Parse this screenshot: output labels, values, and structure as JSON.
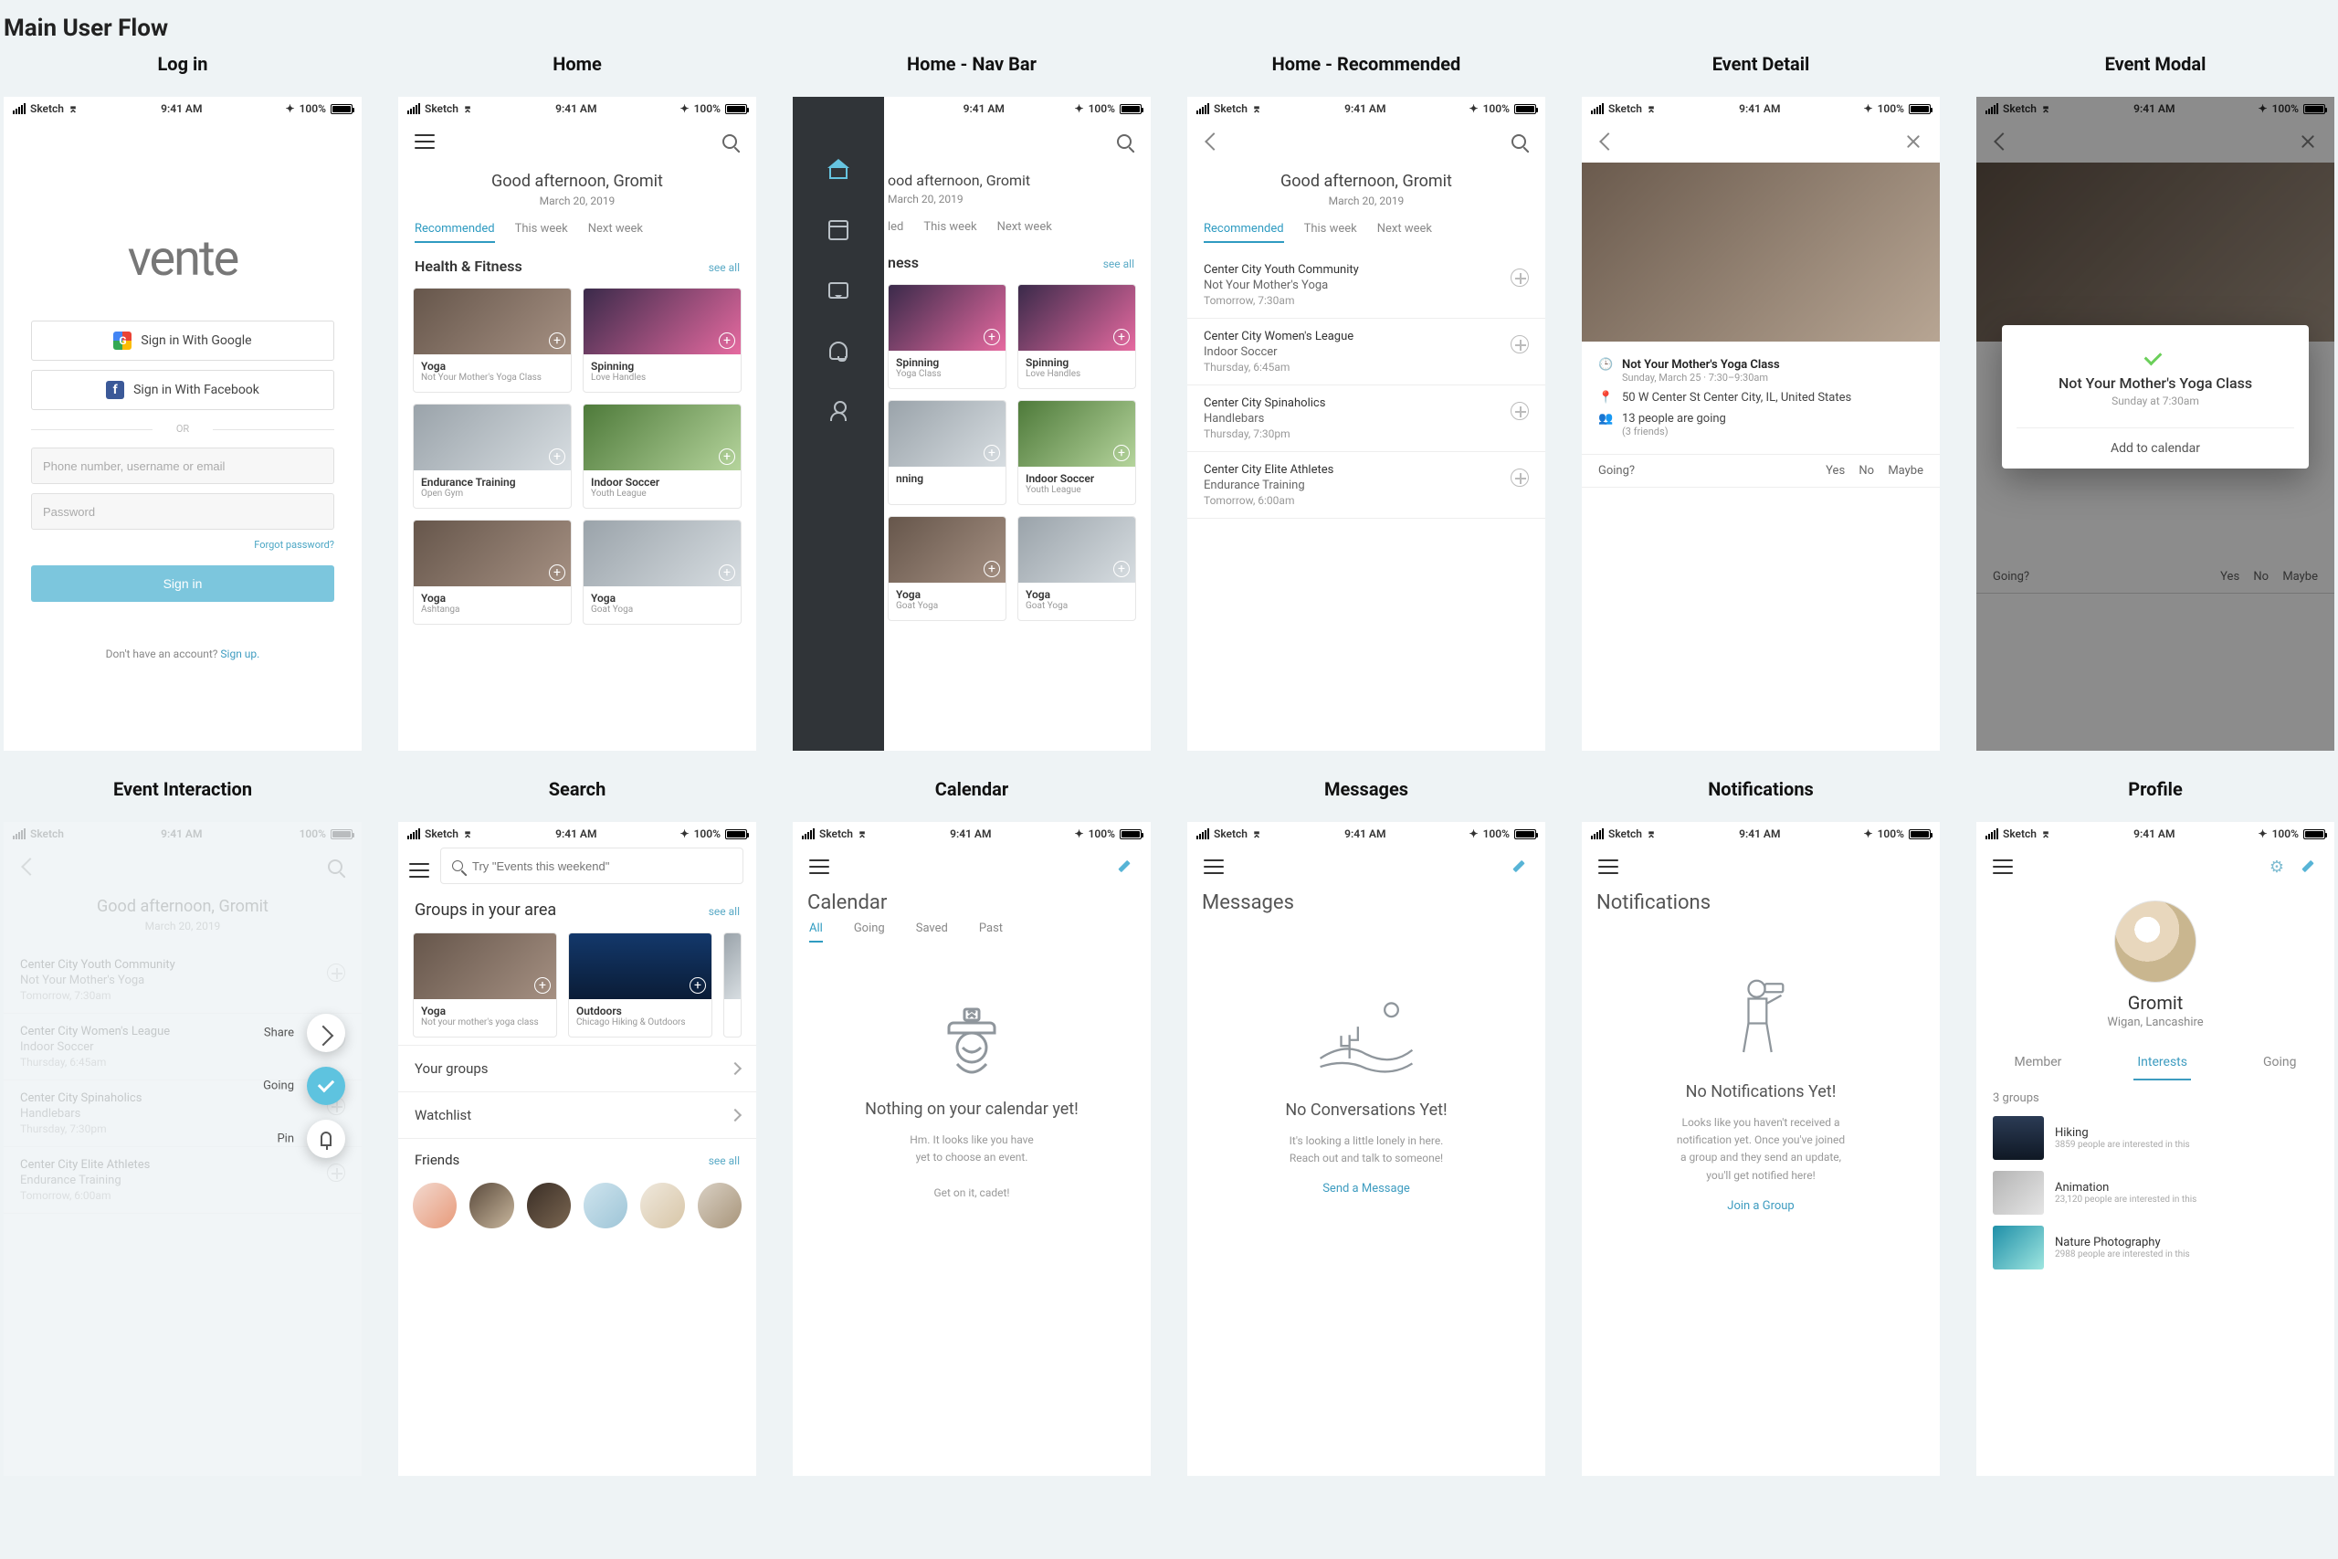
{
  "page_title": "Main User Flow",
  "status": {
    "carrier": "Sketch",
    "time": "9:41 AM",
    "battery": "100%"
  },
  "labels": {
    "login": "Log in",
    "home": "Home",
    "homeNav": "Home - Nav Bar",
    "homeRec": "Home - Recommended",
    "eventDetail": "Event Detail",
    "eventModal": "Event Modal",
    "eventInteraction": "Event Interaction",
    "search": "Search",
    "calendar": "Calendar",
    "messages": "Messages",
    "notifications": "Notifications",
    "profile": "Profile"
  },
  "login": {
    "brand": "vente",
    "google": "Sign in With Google",
    "facebook": "Sign in With Facebook",
    "or": "OR",
    "user_ph": "Phone number, username or email",
    "pw_ph": "Password",
    "forgot": "Forgot password?",
    "signin": "Sign in",
    "noacct": "Don't have an account? ",
    "signup": "Sign up."
  },
  "home": {
    "greeting": "Good afternoon, Gromit",
    "date": "March 20, 2019",
    "tabs": {
      "rec": "Recommended",
      "week": "This week",
      "next": "Next week"
    },
    "section": "Health & Fitness",
    "see_all": "see all",
    "cards": [
      {
        "t": "Yoga",
        "s": "Not Your Mother's Yoga Class",
        "cls": "yoga"
      },
      {
        "t": "Spinning",
        "s": "Love Handles",
        "cls": "spin"
      },
      {
        "t": "Endurance Training",
        "s": "Open Gym",
        "cls": "gym"
      },
      {
        "t": "Indoor Soccer",
        "s": "Youth League",
        "cls": "soccer"
      },
      {
        "t": "Yoga",
        "s": "Ashtanga",
        "cls": "yoga"
      },
      {
        "t": "Yoga",
        "s": "Goat Yoga",
        "cls": "gym"
      }
    ]
  },
  "recList": [
    {
      "l1": "Center City Youth Community",
      "l2": "Not Your Mother's Yoga",
      "l3": "Tomorrow, 7:30am"
    },
    {
      "l1": "Center City Women's League",
      "l2": "Indoor Soccer",
      "l3": "Thursday, 6:45am"
    },
    {
      "l1": "Center City Spinaholics",
      "l2": "Handlebars",
      "l3": "Thursday, 7:30pm"
    },
    {
      "l1": "Center City Elite Athletes",
      "l2": "Endurance Training",
      "l3": "Tomorrow, 6:00am"
    }
  ],
  "detail": {
    "title": "Not Your Mother's Yoga Class",
    "when": "Sunday, March 25  ·  7:30–9:30am",
    "where": "50 W Center St Center City, IL, United States",
    "people": "13 people are going",
    "friends": "(3 friends)",
    "going": "Going?",
    "yes": "Yes",
    "no": "No",
    "maybe": "Maybe"
  },
  "modal": {
    "title": "Not Your Mother's Yoga Class",
    "sub": "Sunday at 7:30am",
    "action": "Add to calendar"
  },
  "interaction": {
    "share": "Share",
    "going": "Going",
    "pin": "Pin"
  },
  "search": {
    "placeholder": "Try \"Events this weekend\"",
    "groups": "Groups in your area",
    "see_all": "see all",
    "cards": [
      {
        "t": "Yoga",
        "s": "Not your mother's yoga class",
        "cls": "yoga"
      },
      {
        "t": "Outdoors",
        "s": "Chicago Hiking & Outdoors",
        "cls": "hike"
      }
    ],
    "yourGroups": "Your groups",
    "watchlist": "Watchlist",
    "friends": "Friends"
  },
  "calendar": {
    "title": "Calendar",
    "tabs": {
      "all": "All",
      "going": "Going",
      "saved": "Saved",
      "past": "Past"
    },
    "h": "Nothing on your calendar yet!",
    "p1": "Hm. It looks like you have",
    "p2": "yet to choose an event.",
    "p3": "Get on it, cadet!"
  },
  "messages": {
    "title": "Messages",
    "h": "No Conversations Yet!",
    "p1": "It's looking a little lonely in here.",
    "p2": "Reach out and talk to someone!",
    "link": "Send a Message"
  },
  "notifications": {
    "title": "Notifications",
    "h": "No Notifications Yet!",
    "p1": "Looks like you haven't received a",
    "p2": "notification yet. Once you've  joined",
    "p3": "a group and they send an update,",
    "p4": "you'll get notified here!",
    "link": "Join a Group"
  },
  "profile": {
    "name": "Gromit",
    "loc": "Wigan, Lancashire",
    "tabs": {
      "member": "Member",
      "interests": "Interests",
      "going": "Going"
    },
    "count": "3 groups",
    "groups": [
      {
        "t": "Hiking",
        "s": "3859 people are interested in this",
        "cls": "mount"
      },
      {
        "t": "Animation",
        "s": "23,120 people are interested in this",
        "cls": "anim"
      },
      {
        "t": "Nature Photography",
        "s": "2988 people are interested in this",
        "cls": "nav"
      }
    ]
  },
  "navHome": {
    "section_partial": "ness",
    "cards": [
      {
        "t": "Spinning",
        "s": "Yoga Class",
        "cls": "spin"
      },
      {
        "t": "Spinning",
        "s": "Love Handles",
        "cls": "spin"
      },
      {
        "t": "nning",
        "s": "",
        "cls": "gym"
      },
      {
        "t": "Indoor Soccer",
        "s": "Youth League",
        "cls": "soccer"
      },
      {
        "t": "Yoga",
        "s": "Goat Yoga",
        "cls": "yoga"
      },
      {
        "t": "Yoga",
        "s": "Goat Yoga",
        "cls": "gym"
      }
    ]
  }
}
